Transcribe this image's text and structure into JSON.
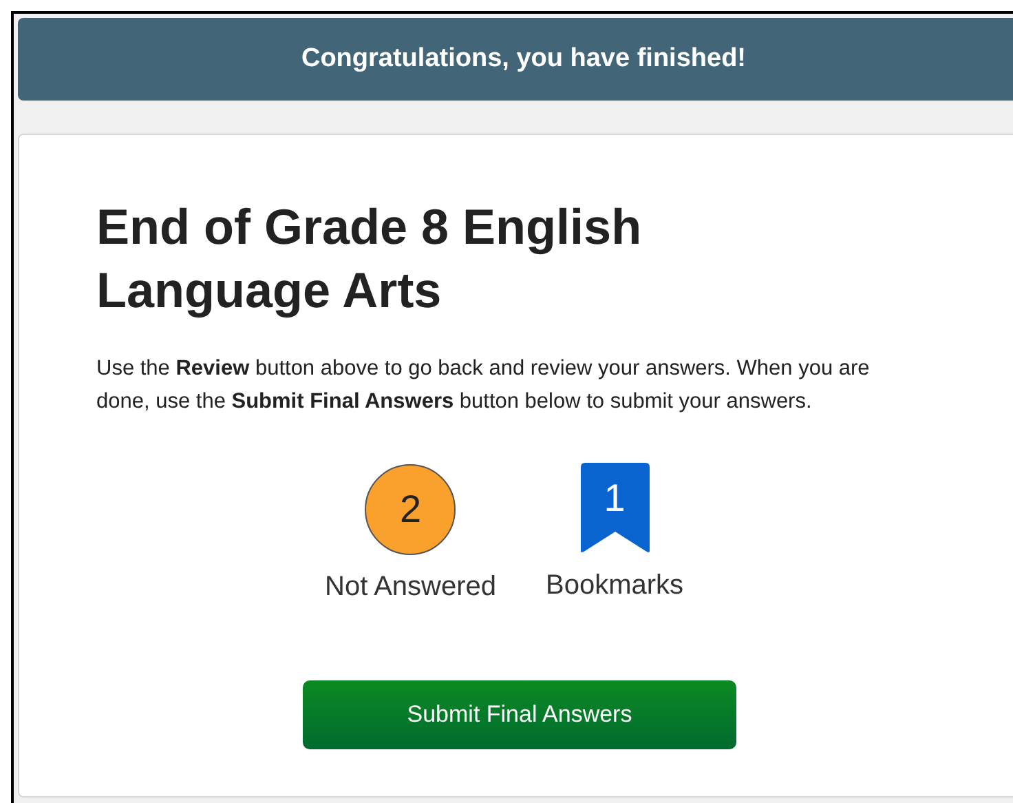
{
  "banner": {
    "title": "Congratulations, you have finished!"
  },
  "card": {
    "title": "End of Grade 8 English Language Arts",
    "instructions": "Use the **Review** button above to go back and review your answers. When you are done, use the **Submit Final Answers** button below to submit your answers.",
    "stats": [
      {
        "kind": "circle",
        "count": "2",
        "label": "Not Answered"
      },
      {
        "kind": "bookmark",
        "count": "1",
        "label": "Bookmarks"
      }
    ],
    "submit_button": "Submit Final Answers"
  }
}
